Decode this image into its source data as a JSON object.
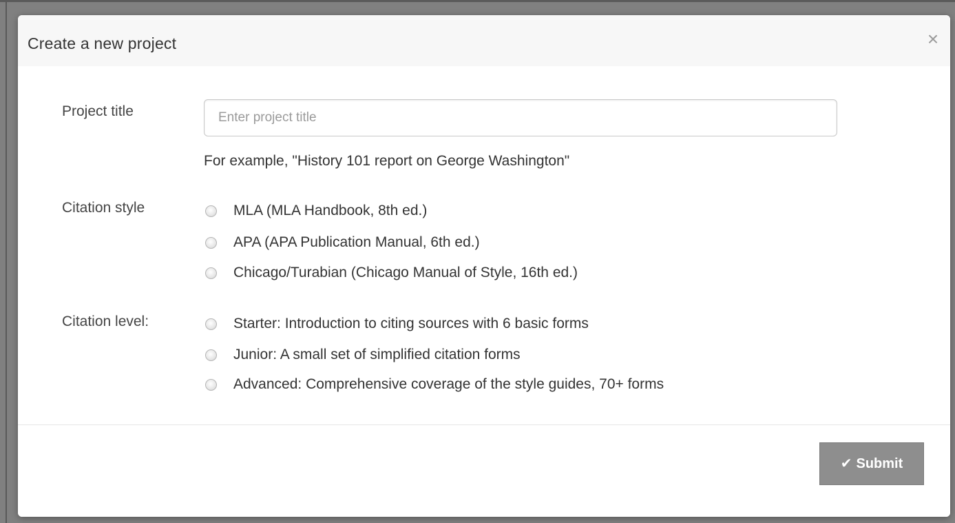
{
  "modal": {
    "title": "Create a new project",
    "close_glyph": "×"
  },
  "form": {
    "project_title": {
      "label": "Project title",
      "placeholder": "Enter project title",
      "value": "",
      "help": "For example, \"History 101 report on George Washington\""
    },
    "citation_style": {
      "label": "Citation style",
      "options": [
        {
          "label": "MLA (MLA Handbook, 8th ed.)",
          "selected": false
        },
        {
          "label": "APA (APA Publication Manual, 6th ed.)",
          "selected": false
        },
        {
          "label": "Chicago/Turabian (Chicago Manual of Style, 16th ed.)",
          "selected": false
        }
      ]
    },
    "citation_level": {
      "label": "Citation level:",
      "options": [
        {
          "label": "Starter: Introduction to citing sources with 6 basic forms",
          "selected": false
        },
        {
          "label": "Junior: A small set of simplified citation forms",
          "selected": false
        },
        {
          "label": "Advanced: Comprehensive coverage of the style guides, 70+ forms",
          "selected": false
        }
      ]
    }
  },
  "footer": {
    "submit_label": "Submit",
    "submit_icon": "check-icon"
  }
}
